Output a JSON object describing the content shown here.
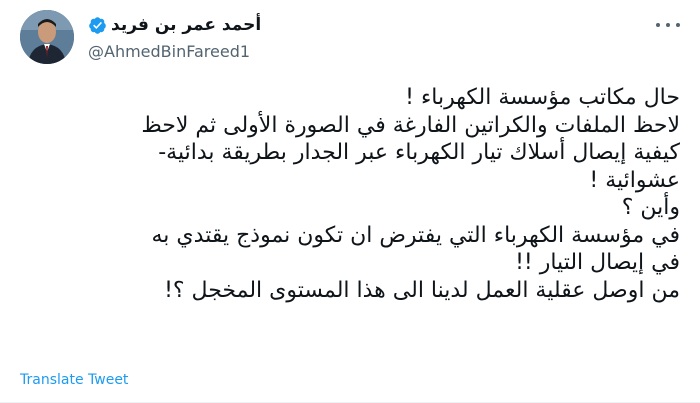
{
  "author": {
    "display_name": "أحمد عمر بن فريد",
    "handle": "@AhmedBinFareed1",
    "verified": true,
    "avatar_icon": "profile-photo"
  },
  "tweet": {
    "lines": [
      "حال مكاتب مؤسسة الكهرباء !",
      "لاحظ الملفات والكراتين الفارغة في الصورة الأولى ثم لاحظ",
      "كيفية إيصال أسلاك تيار الكهرباء عبر الجدار بطريقة بدائية-",
      "عشوائية !",
      "وأين ؟",
      "في مؤسسة الكهرباء التي يفترض ان تكون نموذج يقتدي به",
      "في إيصال التيار !!",
      "من اوصل عقلية العمل لدينا الى هذا المستوى المخجل ؟!"
    ]
  },
  "actions": {
    "translate_label": "Translate Tweet"
  },
  "colors": {
    "accent": "#1d9bf0",
    "text": "#0f1419",
    "secondary": "#536471"
  }
}
